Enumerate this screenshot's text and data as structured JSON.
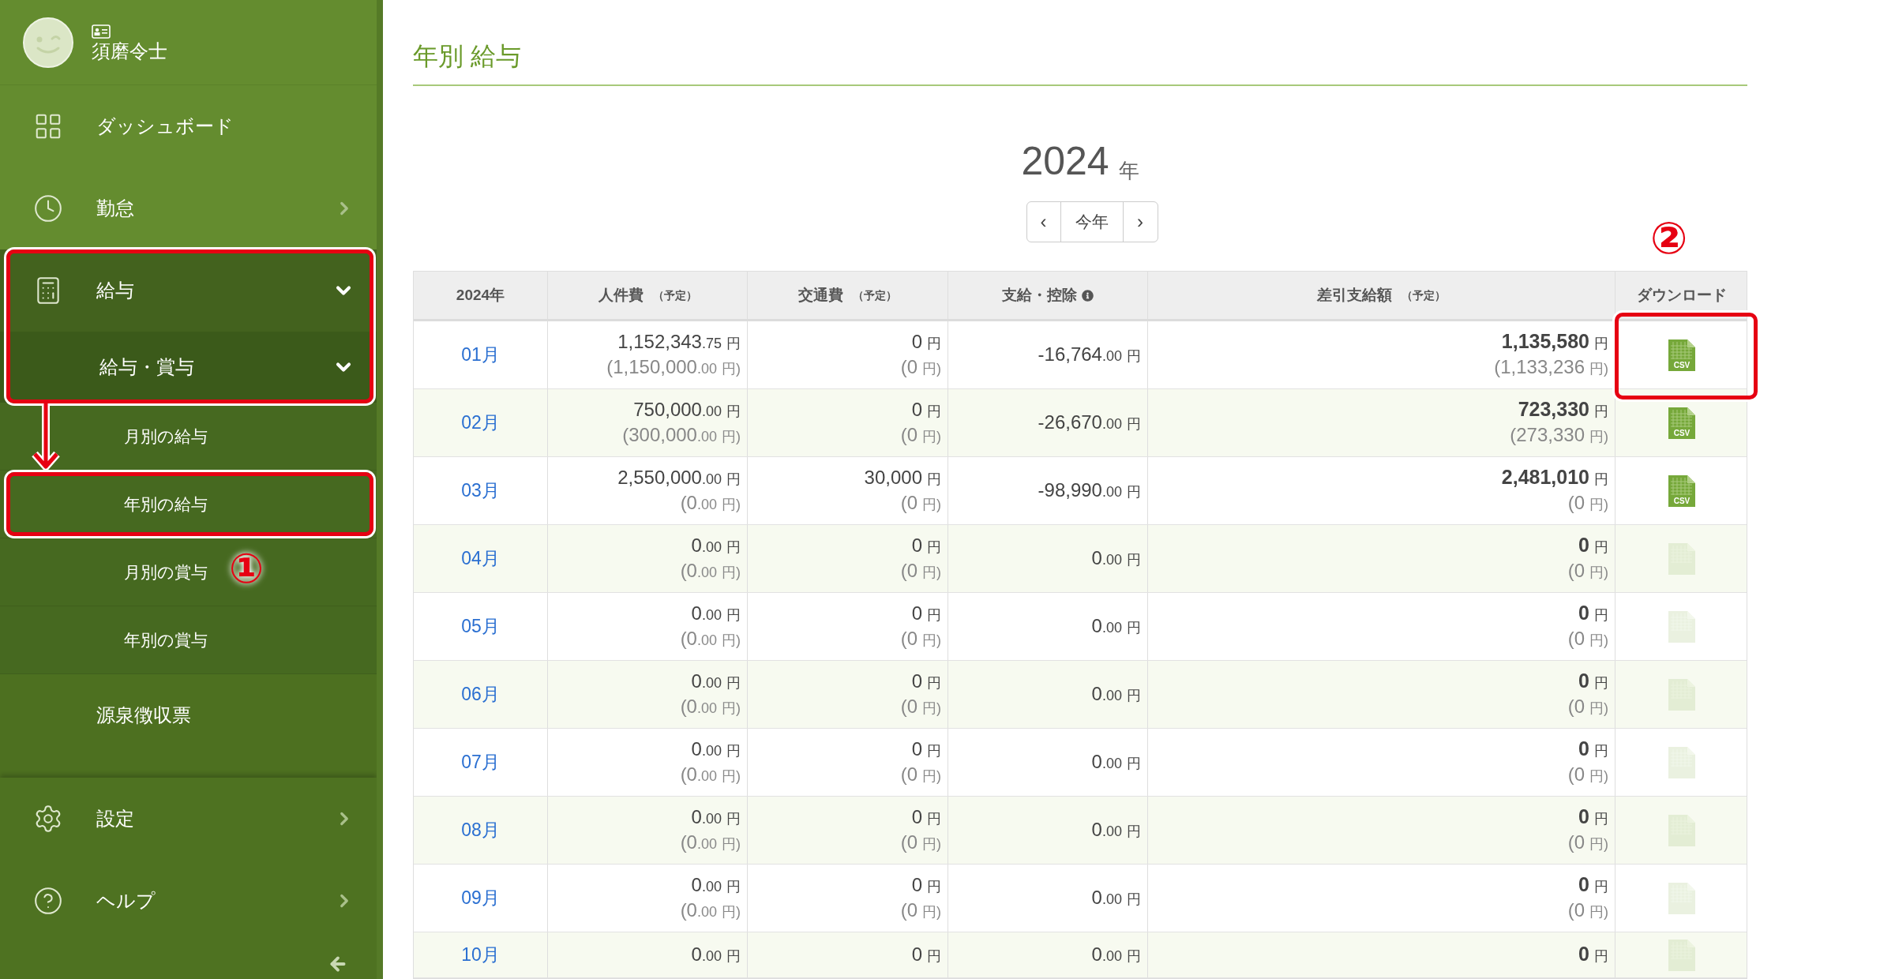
{
  "profile": {
    "name": "須磨令士"
  },
  "nav": [
    {
      "label": "ダッシュボード",
      "kind": "dashboard",
      "selected": false
    },
    {
      "label": "勤怠",
      "kind": "clock",
      "selected": false,
      "expanded": false
    },
    {
      "label": "給与",
      "kind": "calculator",
      "selected": true,
      "expanded": true,
      "highlighted": true,
      "children": [
        {
          "label": "給与・賞与",
          "expanded": true,
          "children": [
            {
              "label": "月別の給与",
              "highlighted": false
            },
            {
              "label": "年別の給与",
              "highlighted": true
            },
            {
              "label": "月別の賞与",
              "highlighted": false
            },
            {
              "label": "年別の賞与",
              "highlighted": false
            }
          ]
        }
      ]
    },
    {
      "label": "源泉徴収票",
      "kind": "plain",
      "selected": false
    }
  ],
  "footer_nav": [
    {
      "label": "設定",
      "kind": "gear",
      "expanded": false
    },
    {
      "label": "ヘルプ",
      "kind": "help",
      "expanded": false
    }
  ],
  "annotations": [
    {
      "label": "①"
    },
    {
      "label": "②"
    }
  ],
  "page_title": "年別 給与",
  "year": {
    "value": "2024",
    "unit": "年",
    "today_button": "今年",
    "prev": "‹",
    "next": "›"
  },
  "table": {
    "columns": [
      {
        "label": "2024年"
      },
      {
        "label": "人件費",
        "note": "（予定）"
      },
      {
        "label": "交通費",
        "note": "（予定）"
      },
      {
        "label": "支給・控除",
        "info": true
      },
      {
        "label": "差引支給額",
        "note": "（予定）"
      },
      {
        "label": "ダウンロード"
      }
    ],
    "rows": [
      {
        "month": "01月",
        "labor": [
          {
            "value": "1,152,343",
            "decimals": ".75",
            "unit": "円"
          },
          {
            "value": "(1,150,000",
            "decimals": ".00",
            "unit": "円)"
          }
        ],
        "transport": [
          {
            "value": "0",
            "unit": "円"
          },
          {
            "value": "(0",
            "unit": "円)"
          }
        ],
        "deduction": [
          {
            "value": "-16,764",
            "decimals": ".00",
            "unit": "円"
          }
        ],
        "net": [
          {
            "value": "1,135,580",
            "unit": "円"
          },
          {
            "value": "(1,133,236",
            "unit": "円)"
          }
        ],
        "csv": {
          "label": "CSV",
          "enabled": true,
          "highlighted": true
        }
      },
      {
        "month": "02月",
        "labor": [
          {
            "value": "750,000",
            "decimals": ".00",
            "unit": "円"
          },
          {
            "value": "(300,000",
            "decimals": ".00",
            "unit": "円)"
          }
        ],
        "transport": [
          {
            "value": "0",
            "unit": "円"
          },
          {
            "value": "(0",
            "unit": "円)"
          }
        ],
        "deduction": [
          {
            "value": "-26,670",
            "decimals": ".00",
            "unit": "円"
          }
        ],
        "net": [
          {
            "value": "723,330",
            "unit": "円"
          },
          {
            "value": "(273,330",
            "unit": "円)"
          }
        ],
        "csv": {
          "label": "CSV",
          "enabled": true,
          "highlighted": false
        }
      },
      {
        "month": "03月",
        "labor": [
          {
            "value": "2,550,000",
            "decimals": ".00",
            "unit": "円"
          },
          {
            "value": "(0",
            "decimals": ".00",
            "unit": "円)"
          }
        ],
        "transport": [
          {
            "value": "30,000",
            "unit": "円"
          },
          {
            "value": "(0",
            "unit": "円)"
          }
        ],
        "deduction": [
          {
            "value": "-98,990",
            "decimals": ".00",
            "unit": "円"
          }
        ],
        "net": [
          {
            "value": "2,481,010",
            "unit": "円"
          },
          {
            "value": "(0",
            "unit": "円)"
          }
        ],
        "csv": {
          "label": "CSV",
          "enabled": true,
          "highlighted": false
        }
      },
      {
        "month": "04月",
        "labor": [
          {
            "value": "0",
            "decimals": ".00",
            "unit": "円"
          },
          {
            "value": "(0",
            "decimals": ".00",
            "unit": "円)"
          }
        ],
        "transport": [
          {
            "value": "0",
            "unit": "円"
          },
          {
            "value": "(0",
            "unit": "円)"
          }
        ],
        "deduction": [
          {
            "value": "0",
            "decimals": ".00",
            "unit": "円"
          }
        ],
        "net": [
          {
            "value": "0",
            "unit": "円"
          },
          {
            "value": "(0",
            "unit": "円)"
          }
        ],
        "csv": {
          "enabled": false,
          "highlighted": false
        }
      },
      {
        "month": "05月",
        "labor": [
          {
            "value": "0",
            "decimals": ".00",
            "unit": "円"
          },
          {
            "value": "(0",
            "decimals": ".00",
            "unit": "円)"
          }
        ],
        "transport": [
          {
            "value": "0",
            "unit": "円"
          },
          {
            "value": "(0",
            "unit": "円)"
          }
        ],
        "deduction": [
          {
            "value": "0",
            "decimals": ".00",
            "unit": "円"
          }
        ],
        "net": [
          {
            "value": "0",
            "unit": "円"
          },
          {
            "value": "(0",
            "unit": "円)"
          }
        ],
        "csv": {
          "enabled": false,
          "highlighted": false
        }
      },
      {
        "month": "06月",
        "labor": [
          {
            "value": "0",
            "decimals": ".00",
            "unit": "円"
          },
          {
            "value": "(0",
            "decimals": ".00",
            "unit": "円)"
          }
        ],
        "transport": [
          {
            "value": "0",
            "unit": "円"
          },
          {
            "value": "(0",
            "unit": "円)"
          }
        ],
        "deduction": [
          {
            "value": "0",
            "decimals": ".00",
            "unit": "円"
          }
        ],
        "net": [
          {
            "value": "0",
            "unit": "円"
          },
          {
            "value": "(0",
            "unit": "円)"
          }
        ],
        "csv": {
          "enabled": false,
          "highlighted": false
        }
      },
      {
        "month": "07月",
        "labor": [
          {
            "value": "0",
            "decimals": ".00",
            "unit": "円"
          },
          {
            "value": "(0",
            "decimals": ".00",
            "unit": "円)"
          }
        ],
        "transport": [
          {
            "value": "0",
            "unit": "円"
          },
          {
            "value": "(0",
            "unit": "円)"
          }
        ],
        "deduction": [
          {
            "value": "0",
            "decimals": ".00",
            "unit": "円"
          }
        ],
        "net": [
          {
            "value": "0",
            "unit": "円"
          },
          {
            "value": "(0",
            "unit": "円)"
          }
        ],
        "csv": {
          "enabled": false,
          "highlighted": false
        }
      },
      {
        "month": "08月",
        "labor": [
          {
            "value": "0",
            "decimals": ".00",
            "unit": "円"
          },
          {
            "value": "(0",
            "decimals": ".00",
            "unit": "円)"
          }
        ],
        "transport": [
          {
            "value": "0",
            "unit": "円"
          },
          {
            "value": "(0",
            "unit": "円)"
          }
        ],
        "deduction": [
          {
            "value": "0",
            "decimals": ".00",
            "unit": "円"
          }
        ],
        "net": [
          {
            "value": "0",
            "unit": "円"
          },
          {
            "value": "(0",
            "unit": "円)"
          }
        ],
        "csv": {
          "enabled": false,
          "highlighted": false
        }
      },
      {
        "month": "09月",
        "labor": [
          {
            "value": "0",
            "decimals": ".00",
            "unit": "円"
          },
          {
            "value": "(0",
            "decimals": ".00",
            "unit": "円)"
          }
        ],
        "transport": [
          {
            "value": "0",
            "unit": "円"
          },
          {
            "value": "(0",
            "unit": "円)"
          }
        ],
        "deduction": [
          {
            "value": "0",
            "decimals": ".00",
            "unit": "円"
          }
        ],
        "net": [
          {
            "value": "0",
            "unit": "円"
          },
          {
            "value": "(0",
            "unit": "円)"
          }
        ],
        "csv": {
          "enabled": false,
          "highlighted": false
        }
      },
      {
        "month": "10月",
        "labor": [
          {
            "value": "0",
            "decimals": ".00",
            "unit": "円"
          }
        ],
        "transport": [
          {
            "value": "0",
            "unit": "円"
          }
        ],
        "deduction": [
          {
            "value": "0",
            "decimals": ".00",
            "unit": "円"
          }
        ],
        "net": [
          {
            "value": "0",
            "unit": "円"
          }
        ],
        "csv": {
          "enabled": false,
          "highlighted": false
        }
      }
    ]
  }
}
